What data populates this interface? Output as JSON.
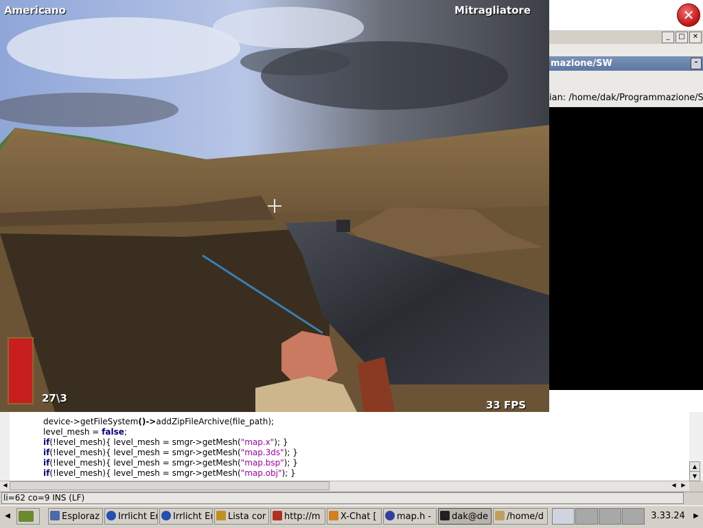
{
  "game": {
    "team": "Americano",
    "weapon": "Mitragliatore",
    "ammo": "27\\3",
    "fps": "33 FPS"
  },
  "right_window": {
    "panel_title": "mazione/SW",
    "terminal_title": "ian: /home/dak/Programmazione/SW",
    "min_glyph": "_",
    "max_glyph": "□",
    "close_glyph": "✕",
    "panel_min_glyph": "–",
    "close_big_glyph": "✕"
  },
  "editor": {
    "lines": [
      [
        "device->",
        "getFileSystem",
        "()->",
        "addZipFileArchive",
        "(file_path);"
      ],
      [
        "level_mesh = ",
        "false",
        ";"
      ],
      [
        "if",
        "(!level_mesh){ level_mesh = smgr->getMesh(",
        "\"map.x\"",
        "); }"
      ],
      [
        "if",
        "(!level_mesh){ level_mesh = smgr->getMesh(",
        "\"map.3ds\"",
        "); }"
      ],
      [
        "if",
        "(!level_mesh){ level_mesh = smgr->getMesh(",
        "\"map.bsp\"",
        "); }"
      ],
      [
        "if",
        "(!level_mesh){ level_mesh = smgr->getMesh(",
        "\"map.obj\"",
        "); }"
      ]
    ],
    "status": "li=62 co=9 INS (LF)",
    "scroll_up": "▲",
    "scroll_down": "▼",
    "scroll_left": "◀",
    "scroll_right": "▶"
  },
  "taskbar": {
    "left_arrow": "◀",
    "right_arrow": "▶",
    "items": [
      {
        "label": "Esploraz",
        "icon": "file-manager-icon",
        "color": "#4a6aa8"
      },
      {
        "label": "Irrlicht Er",
        "icon": "globe-icon",
        "color": "#2050b0"
      },
      {
        "label": "Irrlicht Er",
        "icon": "globe-icon",
        "color": "#2050b0"
      },
      {
        "label": "Lista cor",
        "icon": "contacts-icon",
        "color": "#c09020"
      },
      {
        "label": "http://m",
        "icon": "browser-icon",
        "color": "#b03020"
      },
      {
        "label": "X-Chat [",
        "icon": "xchat-icon",
        "color": "#d08020"
      },
      {
        "label": "map.h -",
        "icon": "editor-icon",
        "color": "#3040a0"
      },
      {
        "label": "dak@de",
        "icon": "terminal-icon",
        "color": "#202020"
      },
      {
        "label": "/home/d",
        "icon": "folder-icon",
        "color": "#c0a060"
      }
    ],
    "clock": "3.33.24"
  }
}
